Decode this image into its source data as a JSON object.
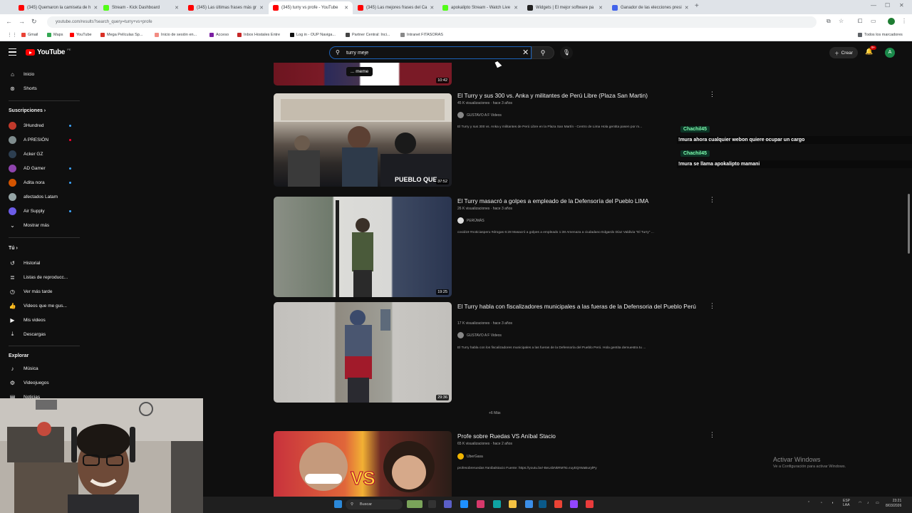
{
  "browser": {
    "tabs": [
      {
        "label": "(345) Quemaron la camiseta de h",
        "color": "#ff0000"
      },
      {
        "label": "Stream - Kick Dashboard",
        "color": "#53fc18"
      },
      {
        "label": "(345) Las últimas frases más gr",
        "color": "#ff0000"
      },
      {
        "label": "(345) turry vs profe - YouTube",
        "color": "#ff0000"
      },
      {
        "label": "(345) Las mejores frases del Ca",
        "color": "#ff0000"
      },
      {
        "label": "apokalipto Stream - Watch Live",
        "color": "#53fc18"
      },
      {
        "label": "Widgets | El mejor software pa",
        "color": "#222222"
      },
      {
        "label": "Ganador de las elecciones presi",
        "color": "#4263eb"
      }
    ],
    "active_tab": 3,
    "new_tab": "+",
    "url": "youtube.com/results?search_query=turry+vs+profe",
    "bookmarks": [
      {
        "label": "Gmail",
        "color": "#ea4335"
      },
      {
        "label": "Maps",
        "color": "#34a853"
      },
      {
        "label": "YouTube",
        "color": "#ff0000"
      },
      {
        "label": "Mega Películas Sp...",
        "color": "#d93025"
      },
      {
        "label": "Inicio de sesión en...",
        "color": "#f28b82"
      },
      {
        "label": "Acceso",
        "color": "#7b1fa2"
      },
      {
        "label": "Inbox Hostales Entre",
        "color": "#c62828"
      },
      {
        "label": "Log in - OUP Naviga...",
        "color": "#111111"
      },
      {
        "label": "Partner Central: Inci...",
        "color": "#444444"
      },
      {
        "label": "Intranet FITASORAS",
        "color": "#888888"
      }
    ],
    "all_bookmarks": "Todos los marcadores"
  },
  "header": {
    "logo": "YouTube",
    "logo_country": "PE",
    "search_value": "turry meje",
    "create_label": "Crear",
    "notif_count": "9+",
    "avatar_letter": "A"
  },
  "sidebar": {
    "top": [
      {
        "label": "Inicio",
        "icon": "⌂"
      },
      {
        "label": "Shorts",
        "icon": "⊛"
      }
    ],
    "subs_header": "Suscripciones",
    "subs": [
      {
        "label": "3Hundred",
        "color": "#c0392b",
        "dot": "blue"
      },
      {
        "label": "A PRESIÓN",
        "color": "#7f8c8d",
        "dot": "red"
      },
      {
        "label": "Acker GZ",
        "color": "#2c3e50",
        "dot": ""
      },
      {
        "label": "AD Gamer",
        "color": "#8e44ad",
        "dot": "blue"
      },
      {
        "label": "Adita nora",
        "color": "#d35400",
        "dot": "blue"
      },
      {
        "label": "afectados Latam",
        "color": "#95a5a6",
        "dot": ""
      },
      {
        "label": "Air Supply",
        "color": "#6c5ce7",
        "dot": "blue"
      }
    ],
    "show_more": "Mostrar más",
    "you_header": "Tú",
    "you": [
      {
        "label": "Historial",
        "icon": "↺"
      },
      {
        "label": "Listas de reproducc...",
        "icon": "≣"
      },
      {
        "label": "Ver más tarde",
        "icon": "◷"
      },
      {
        "label": "Videos que me gus...",
        "icon": "♡"
      },
      {
        "label": "Mis videos",
        "icon": "▶"
      },
      {
        "label": "Descargas",
        "icon": "⤓"
      }
    ],
    "explore_header": "Explorar",
    "explore": [
      {
        "label": "Música",
        "icon": "♪"
      },
      {
        "label": "Videojuegos",
        "icon": "⚙"
      },
      {
        "label": "Noticias",
        "icon": "▤"
      }
    ]
  },
  "results": [
    {
      "title": "",
      "duration": "10:42",
      "overlay": "... meme"
    },
    {
      "title": "El Turry y sus 300 vs. Anka y militantes de Perú Libre (Plaza San Martin)",
      "meta": "45 K visualizaciones · hace 3 años",
      "channel": "GUSTAVO A F Videos",
      "desc": "El Turry y sus 300 vs. Anka y militantes de Perú Libre en la Plaza San Martín - Centro de Lima Hola gentita pasen por m...",
      "duration": "37:52"
    },
    {
      "title": "El Turry masacró a golpes a empleado de la Defensoría del Pueblo LIMA",
      "meta": "26 K visualizaciones · hace 3 años",
      "channel": "PERÚMÁS",
      "desc": "covid19 #noticiasperu #drogas 6:28 Masacró a golpes a empleado 1:38 Amenaza a ciudadano Edgardo Díaz Valdivia \"El Turry\" ...",
      "duration": "19:25"
    },
    {
      "title": "El Turry habla con fiscalizadores municipales a las fueras de la Defensoria del Pueblo Perú",
      "meta": "17 K visualizaciones · hace 3 años",
      "channel": "GUSTAVO A F Videos",
      "desc": "El Turry habla con los fiscalizadores municipales a las fueras de la Defensoría del Pueblo Perú. Hola gentita demuestra tu ...",
      "duration": "29:36"
    },
    {
      "title": "Profe sobre Ruedas VS Aníbal Stacio",
      "meta": "65 K visualizaciones · hace 2 años",
      "channel": "UberGasa",
      "desc": "profesobreruedas #anibalstacio Fuente: https://youtu.be/-BeLsbNkRMTsi=IuyEQrWaBurylPy",
      "duration": ""
    }
  ],
  "more_results": "+6 Más",
  "chat": [
    {
      "name": "Chachil45",
      "msg": "!mura ahora cualquier webon quiere ocupar un cargo"
    },
    {
      "name": "Chachil45",
      "msg": "!mura se llama apokalipto mamani"
    }
  ],
  "activate": {
    "line1": "Activar Windows",
    "line2": "Ve a Configuración para activar Windows."
  },
  "taskbar": {
    "search": "Buscar",
    "time": "23:21",
    "date": "8/03/2026",
    "lang": "ESP LAA"
  }
}
